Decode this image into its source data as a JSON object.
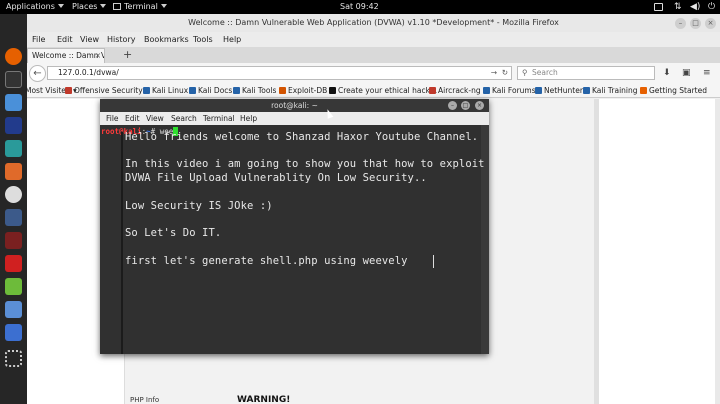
{
  "topbar": {
    "applications": "Applications",
    "places": "Places",
    "terminal": "Terminal",
    "clock": "Sat 09:42"
  },
  "firefox": {
    "window_title": "Welcome :: Damn Vulnerable Web Application (DVWA) v1.10 *Development* - Mozilla Firefox",
    "menu": [
      "File",
      "Edit",
      "View",
      "History",
      "Bookmarks",
      "Tools",
      "Help"
    ],
    "tab_label": "Welcome :: Damn Vul...",
    "url": "127.0.0.1/dvwa/",
    "search_placeholder": "Search",
    "bookmarks": [
      "Most Visited",
      "Offensive Security",
      "Kali Linux",
      "Kali Docs",
      "Kali Tools",
      "Exploit-DB",
      "Create your ethical hack...",
      "Aircrack-ng",
      "Kali Forums",
      "NetHunter",
      "Kali Training",
      "Getting Started"
    ],
    "page_link": "PHP Info",
    "page_warning": "WARNING!"
  },
  "terminal": {
    "title": "root@kali: ~",
    "menu": [
      "File",
      "Edit",
      "View",
      "Search",
      "Terminal",
      "Help"
    ],
    "prompt_host": "root@kali",
    "prompt_sep": ":",
    "prompt_path": "~",
    "prompt_symbol": "#",
    "typed": "wee"
  },
  "overlay_lines": [
    "Hello friends welcome to Shanzad Haxor Youtube Channel.",
    "In this video i am going to show you that how to exploit",
    "DVWA File Upload Vulnerablity On Low Security..",
    "Low Security IS JOke :)",
    "So Let's Do IT.",
    "first let's generate shell.php using weevely"
  ],
  "colors": {
    "prompt_host": "#ff3b3b",
    "prompt_path": "#3b7bff",
    "cursor": "#2fe02f",
    "terminal_bg": "#303030"
  }
}
